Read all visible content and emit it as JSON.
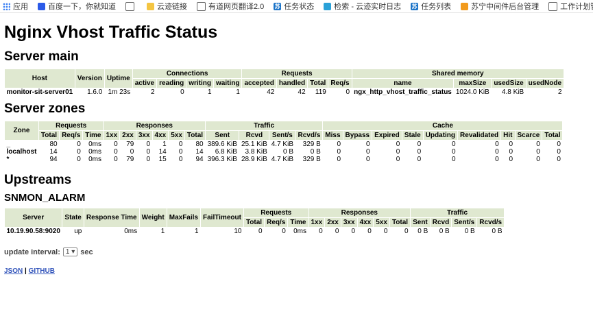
{
  "bookmarks": [
    {
      "icon": "apps-icon",
      "label": "应用"
    },
    {
      "icon": "paw-icon",
      "label": "百度一下，你就知道"
    },
    {
      "icon": "page-icon",
      "label": ""
    },
    {
      "icon": "folder-icon",
      "label": "云迹链接"
    },
    {
      "icon": "page-icon",
      "label": "有道网页翻译2.0"
    },
    {
      "icon": "su-icon",
      "label": "任务状态"
    },
    {
      "icon": "loop-icon",
      "label": "检索 - 云迹实时日志"
    },
    {
      "icon": "su-icon",
      "label": "任务列表"
    },
    {
      "icon": "sun-icon",
      "label": "苏宁中间件后台管理"
    },
    {
      "icon": "page-icon",
      "label": "工作计划管理平台"
    }
  ],
  "title": "Nginx Vhost Traffic Status",
  "server_main": {
    "heading": "Server main",
    "groups": {
      "connections": "Connections",
      "requests": "Requests",
      "shared": "Shared memory"
    },
    "headers": {
      "host": "Host",
      "version": "Version",
      "uptime": "Uptime",
      "active": "active",
      "reading": "reading",
      "writing": "writing",
      "waiting": "waiting",
      "accepted": "accepted",
      "handled": "handled",
      "total": "Total",
      "reqs": "Req/s",
      "name": "name",
      "maxSize": "maxSize",
      "usedSize": "usedSize",
      "usedNode": "usedNode"
    },
    "row": [
      "monitor-sit-server01",
      "1.6.0",
      "1m 23s",
      "2",
      "0",
      "1",
      "1",
      "42",
      "42",
      "119",
      "0",
      "ngx_http_vhost_traffic_status",
      "1024.0 KiB",
      "4.8 KiB",
      "2"
    ]
  },
  "server_zones": {
    "heading": "Server zones",
    "groups": {
      "zone": "Zone",
      "requests": "Requests",
      "responses": "Responses",
      "traffic": "Traffic",
      "cache": "Cache"
    },
    "headers": [
      "Total",
      "Req/s",
      "Time",
      "1xx",
      "2xx",
      "3xx",
      "4xx",
      "5xx",
      "Total",
      "Sent",
      "Rcvd",
      "Sent/s",
      "Rcvd/s",
      "Miss",
      "Bypass",
      "Expired",
      "Stale",
      "Updating",
      "Revalidated",
      "Hit",
      "Scarce",
      "Total"
    ],
    "rows": [
      [
        "_",
        "80",
        "0",
        "0ms",
        "0",
        "79",
        "0",
        "1",
        "0",
        "80",
        "389.6 KiB",
        "25.1 KiB",
        "4.7 KiB",
        "329 B",
        "0",
        "0",
        "0",
        "0",
        "0",
        "0",
        "0",
        "0",
        "0"
      ],
      [
        "localhost",
        "14",
        "0",
        "0ms",
        "0",
        "0",
        "0",
        "14",
        "0",
        "14",
        "6.8 KiB",
        "3.8 KiB",
        "0 B",
        "0 B",
        "0",
        "0",
        "0",
        "0",
        "0",
        "0",
        "0",
        "0",
        "0"
      ],
      [
        "*",
        "94",
        "0",
        "0ms",
        "0",
        "79",
        "0",
        "15",
        "0",
        "94",
        "396.3 KiB",
        "28.9 KiB",
        "4.7 KiB",
        "329 B",
        "0",
        "0",
        "0",
        "0",
        "0",
        "0",
        "0",
        "0",
        "0"
      ]
    ]
  },
  "upstreams": {
    "heading": "Upstreams",
    "group_name": "SNMON_ALARM",
    "groups": {
      "requests": "Requests",
      "responses": "Responses",
      "traffic": "Traffic"
    },
    "headers": {
      "server": "Server",
      "state": "State",
      "rt": "Response Time",
      "weight": "Weight",
      "maxfails": "MaxFails",
      "failtimeout": "FailTimeout"
    },
    "sub": [
      "Total",
      "Req/s",
      "Time",
      "1xx",
      "2xx",
      "3xx",
      "4xx",
      "5xx",
      "Total",
      "Sent",
      "Rcvd",
      "Sent/s",
      "Rcvd/s"
    ],
    "row": [
      "10.19.90.58:9020",
      "up",
      "0ms",
      "1",
      "1",
      "10",
      "0",
      "0",
      "0ms",
      "0",
      "0",
      "0",
      "0",
      "0",
      "0",
      "0 B",
      "0 B",
      "0 B",
      "0 B"
    ]
  },
  "update": {
    "label": "update interval:",
    "value": "1",
    "unit": "sec"
  },
  "links": {
    "json": "JSON",
    "sep": "|",
    "github": "GITHUB"
  }
}
